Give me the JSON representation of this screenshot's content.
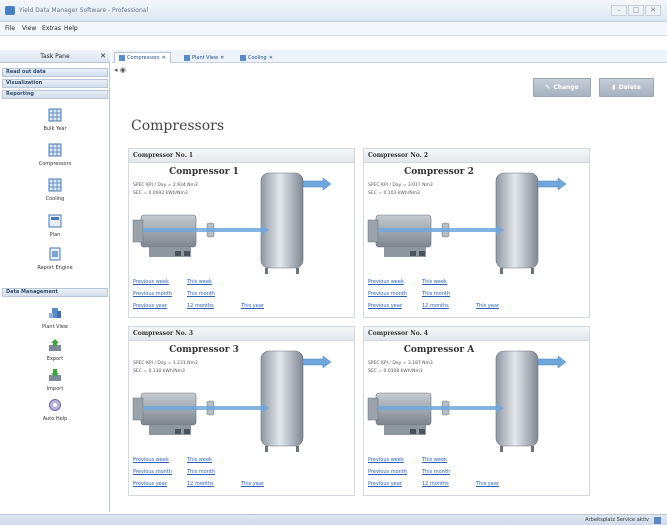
{
  "window": {
    "title": "Yield Data Manager Software - Professional",
    "buttons": [
      "–",
      "□",
      "✕"
    ]
  },
  "menu": [
    "File",
    "View",
    "Extras",
    "Help"
  ],
  "task_pane": {
    "title": "Task Pane",
    "sections": [
      "Read out data",
      "Visualization",
      "Reporting",
      "Data Management"
    ],
    "reporting_items": [
      "Bulk Year",
      "Compressors",
      "Cooling",
      "Plan",
      "Report Engine"
    ],
    "data_items": [
      "Plant View",
      "Export",
      "Import",
      "Auto Help"
    ]
  },
  "tabs": [
    "Compressors",
    "Plant View",
    "Cooling"
  ],
  "buttons": {
    "change": "Change",
    "delete": "Delete"
  },
  "page_title": "Compressors",
  "cards": [
    {
      "header": "Compressor No. 1",
      "title": "Compressor 1",
      "stat1": "SPEC KPI / Day = 2.934 Nm3",
      "stat2": "SEC = 0.0692 kWh/Nm3"
    },
    {
      "header": "Compressor No. 2",
      "title": "Compressor 2",
      "stat1": "SPEC KPI / Day = 3.017 Nm3",
      "stat2": "SEC = 0.103 kWh/Nm3"
    },
    {
      "header": "Compressor No. 3",
      "title": "Compressor 3",
      "stat1": "SPEC KPI / Day = 1.231 Nm3",
      "stat2": "SEC = 0.130 kWh/Nm3"
    },
    {
      "header": "Compressor No. 4",
      "title": "Compressor A",
      "stat1": "SPEC KPI / Day = 3.187 Nm3",
      "stat2": "SEC = 0.0308 kWh/Nm3"
    }
  ],
  "links": {
    "prev_week": "Previous week",
    "this_week": "This week",
    "prev_month": "Previous month",
    "this_month": "This month",
    "prev_year": "Previous year",
    "months12": "12 months",
    "this_year": "This year"
  },
  "status": "Arbeitsplatz Service aktiv"
}
